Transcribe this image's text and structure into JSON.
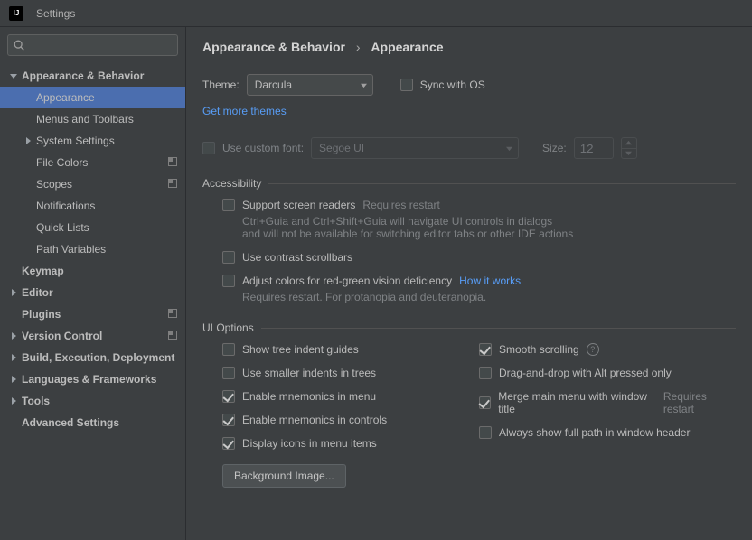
{
  "window": {
    "title": "Settings"
  },
  "search": {
    "placeholder": ""
  },
  "sidebar": {
    "items": [
      {
        "label": "Appearance & Behavior",
        "expandable": true,
        "expanded": true,
        "level": 0
      },
      {
        "label": "Appearance",
        "level": 1,
        "selected": true
      },
      {
        "label": "Menus and Toolbars",
        "level": 1
      },
      {
        "label": "System Settings",
        "level": 1,
        "expandable": true,
        "expanded": false
      },
      {
        "label": "File Colors",
        "level": 1,
        "projectScope": true
      },
      {
        "label": "Scopes",
        "level": 1,
        "projectScope": true
      },
      {
        "label": "Notifications",
        "level": 1
      },
      {
        "label": "Quick Lists",
        "level": 1
      },
      {
        "label": "Path Variables",
        "level": 1
      },
      {
        "label": "Keymap",
        "level": 0
      },
      {
        "label": "Editor",
        "level": 0,
        "expandable": true,
        "expanded": false
      },
      {
        "label": "Plugins",
        "level": 0,
        "projectScope": true
      },
      {
        "label": "Version Control",
        "level": 0,
        "expandable": true,
        "expanded": false,
        "projectScope": true
      },
      {
        "label": "Build, Execution, Deployment",
        "level": 0,
        "expandable": true,
        "expanded": false
      },
      {
        "label": "Languages & Frameworks",
        "level": 0,
        "expandable": true,
        "expanded": false
      },
      {
        "label": "Tools",
        "level": 0,
        "expandable": true,
        "expanded": false
      },
      {
        "label": "Advanced Settings",
        "level": 0
      }
    ]
  },
  "breadcrumb": {
    "root": "Appearance & Behavior",
    "leaf": "Appearance"
  },
  "theme": {
    "label": "Theme:",
    "value": "Darcula",
    "sync_label": "Sync with OS",
    "get_more": "Get more themes"
  },
  "font": {
    "use_custom_label": "Use custom font:",
    "value": "Segoe UI",
    "size_label": "Size:",
    "size_value": "12"
  },
  "accessibility": {
    "heading": "Accessibility",
    "screen_readers": "Support screen readers",
    "requires_restart": "Requires restart",
    "sr_hint1": "Ctrl+Guia and Ctrl+Shift+Guia will navigate UI controls in dialogs",
    "sr_hint2": "and will not be available for switching editor tabs or other IDE actions",
    "contrast": "Use contrast scrollbars",
    "colorblind": "Adjust colors for red-green vision deficiency",
    "how_it_works": "How it works",
    "colorblind_hint": "Requires restart. For protanopia and deuteranopia."
  },
  "ui_options": {
    "heading": "UI Options",
    "left": [
      {
        "label": "Show tree indent guides",
        "checked": false
      },
      {
        "label": "Use smaller indents in trees",
        "checked": false
      },
      {
        "label": "Enable mnemonics in menu",
        "checked": true
      },
      {
        "label": "Enable mnemonics in controls",
        "checked": true
      },
      {
        "label": "Display icons in menu items",
        "checked": true
      }
    ],
    "right": [
      {
        "label": "Smooth scrolling",
        "checked": true,
        "help": true
      },
      {
        "label": "Drag-and-drop with Alt pressed only",
        "checked": false
      },
      {
        "label": "Merge main menu with window title",
        "checked": true,
        "hint": "Requires restart"
      },
      {
        "label": "Always show full path in window header",
        "checked": false
      }
    ],
    "bg_image": "Background Image..."
  }
}
